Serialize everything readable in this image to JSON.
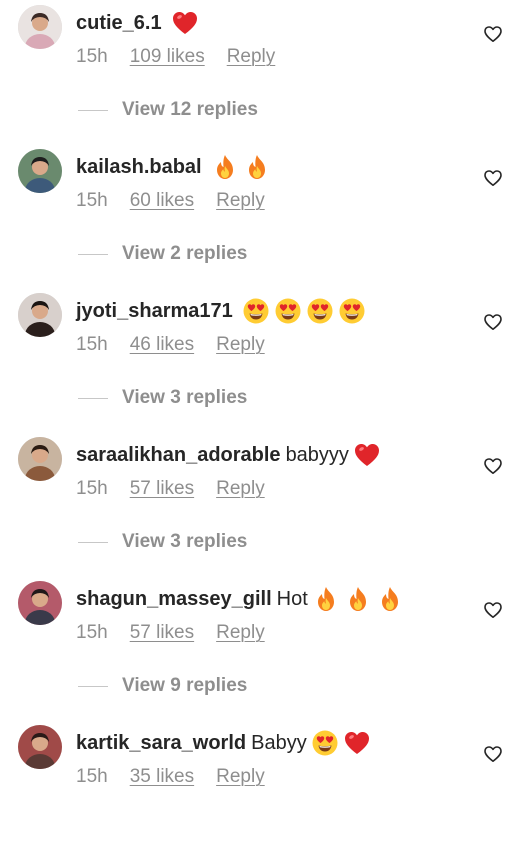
{
  "colors": {
    "text": "#262626",
    "secondary": "#8e8e8e",
    "heart_red": "#e0252a",
    "fire_orange": "#f57d1f"
  },
  "comments": [
    {
      "username": "cutie_6.1",
      "text": "",
      "emojis": [
        "red-heart"
      ],
      "time": "15h",
      "likes": "109 likes",
      "reply": "Reply",
      "view_replies": "View 12 replies",
      "avatar": "pink-dress-avatar"
    },
    {
      "username": "kailash.babal",
      "text": "",
      "emojis": [
        "fire",
        "fire"
      ],
      "time": "15h",
      "likes": "60 likes",
      "reply": "Reply",
      "view_replies": "View 2 replies",
      "avatar": "man-avatar"
    },
    {
      "username": "jyoti_sharma171",
      "text": "",
      "emojis": [
        "heart-eyes",
        "heart-eyes",
        "heart-eyes",
        "heart-eyes"
      ],
      "time": "15h",
      "likes": "46 likes",
      "reply": "Reply",
      "view_replies": "View 3 replies",
      "avatar": "woman-avatar"
    },
    {
      "username": "saraalikhan_adorable",
      "text": "babyyy",
      "emojis": [
        "red-heart"
      ],
      "time": "15h",
      "likes": "57 likes",
      "reply": "Reply",
      "view_replies": "View 3 replies",
      "avatar": "woman-pose-avatar"
    },
    {
      "username": "shagun_massey_gill",
      "text": "Hot",
      "emojis": [
        "fire",
        "fire",
        "fire"
      ],
      "time": "15h",
      "likes": "57 likes",
      "reply": "Reply",
      "view_replies": "View 9 replies",
      "avatar": "couple-avatar"
    },
    {
      "username": "kartik_sara_world",
      "text": "Babyy",
      "emojis": [
        "heart-eyes",
        "red-heart"
      ],
      "time": "15h",
      "likes": "35 likes",
      "reply": "Reply",
      "view_replies": "",
      "avatar": "couple-heart-avatar"
    }
  ]
}
